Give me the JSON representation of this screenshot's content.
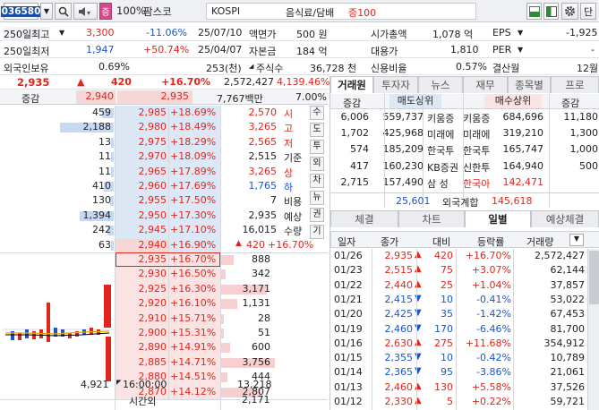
{
  "toolbar": {
    "code": "036580",
    "search_icon": "search-icon",
    "speaker_icon": "speaker-icon",
    "zoom": "100%",
    "name": "팜스코",
    "market": "KOSPI",
    "sector": "음식료/담배",
    "margin": "증100",
    "margin_badge": "증"
  },
  "info": {
    "row1": {
      "l1": "250일최고",
      "v1": "3,300",
      "v2": "-11.06%",
      "v3": "25/07/10",
      "l2": "액면가",
      "v4": "500 원",
      "l3": "시가총액",
      "v5": "1,078 억",
      "l4": "EPS",
      "v6": "-1,925"
    },
    "row2": {
      "l1": "250일최저",
      "v1": "1,947",
      "v2": "+50.74%",
      "v3": "25/04/07",
      "l2": "자본금",
      "v4": "184 억",
      "l3": "대용가",
      "v5": "1,810",
      "l4": "PER",
      "v6": "-"
    },
    "row3": {
      "l1": "외국인보유",
      "v1": "0.69%",
      "v3": "253(천)",
      "l2": "주식수",
      "v4": "36,728 천",
      "l3": "신용비율",
      "v5": "0.57%",
      "l4": "결산월",
      "v6": "12월"
    }
  },
  "quote": {
    "price": "2,935",
    "arrow": "▲",
    "change": "420",
    "rate": "+16.70%",
    "volume": "2,572,427",
    "vol_rate": "4,139.46%",
    "label": "증감",
    "prev": "2,940",
    "cur": "2,935",
    "amount": "7,767백만",
    "turnover": "7.00%"
  },
  "asks": [
    {
      "qty": "459",
      "price": "2,985",
      "rate": "+18.69%"
    },
    {
      "qty": "2,188",
      "price": "2,980",
      "rate": "+18.49%"
    },
    {
      "qty": "13",
      "price": "2,975",
      "rate": "+18.29%"
    },
    {
      "qty": "11",
      "price": "2,970",
      "rate": "+18.09%"
    },
    {
      "qty": "11",
      "price": "2,965",
      "rate": "+17.89%"
    },
    {
      "qty": "410",
      "price": "2,960",
      "rate": "+17.69%"
    },
    {
      "qty": "130",
      "price": "2,955",
      "rate": "+17.50%"
    },
    {
      "qty": "1,394",
      "price": "2,950",
      "rate": "+17.30%"
    },
    {
      "qty": "242",
      "price": "2,945",
      "rate": "+17.10%"
    },
    {
      "qty": "63",
      "price": "2,940",
      "rate": "+16.90%"
    }
  ],
  "bids": [
    {
      "price": "2,935",
      "rate": "+16.70%",
      "qty": "888"
    },
    {
      "price": "2,930",
      "rate": "+16.50%",
      "qty": "342"
    },
    {
      "price": "2,925",
      "rate": "+16.30%",
      "qty": "3,171"
    },
    {
      "price": "2,920",
      "rate": "+16.10%",
      "qty": "1,131"
    },
    {
      "price": "2,910",
      "rate": "+15.71%",
      "qty": "28"
    },
    {
      "price": "2,900",
      "rate": "+15.31%",
      "qty": "51"
    },
    {
      "price": "2,890",
      "rate": "+14.91%",
      "qty": "600"
    },
    {
      "price": "2,885",
      "rate": "+14.71%",
      "qty": "3,756"
    },
    {
      "price": "2,880",
      "rate": "+14.51%",
      "qty": "444"
    },
    {
      "price": "2,870",
      "rate": "+14.12%",
      "qty": "2,807"
    }
  ],
  "summary": [
    {
      "val": "2,570",
      "lbl": "시"
    },
    {
      "val": "3,265",
      "lbl": "고"
    },
    {
      "val": "2,565",
      "lbl": "저"
    },
    {
      "val": "2,515",
      "lbl": "기준"
    },
    {
      "val": "3,265",
      "lbl": "상"
    },
    {
      "val": "1,765",
      "lbl": "하"
    },
    {
      "val": "7",
      "lbl": "비용"
    },
    {
      "val": "2,935",
      "lbl": "예상"
    },
    {
      "val": "16,015",
      "lbl": "수량"
    },
    {
      "arrow": "▲",
      "val": "420",
      "rate": "+16.70%"
    }
  ],
  "side_buttons": [
    "수",
    "도",
    "투",
    "외",
    "차",
    "뉴",
    "권",
    "기"
  ],
  "bottom": {
    "total_ask": "4,921",
    "time": "16:00:00",
    "total_bid": "13,218",
    "after_label": "시간외",
    "after_qty": "2,171"
  },
  "broker_tabs": [
    "거래원",
    "투자자",
    "뉴스",
    "재무",
    "종목별",
    "프로"
  ],
  "broker_header": {
    "h1": "증감",
    "h2": "매도상위",
    "h3": "매수상위",
    "h4": "증감"
  },
  "brokers": [
    {
      "chg": "6,006",
      "sell": "559,737",
      "sname": "키움증",
      "bname": "키움증",
      "buy": "684,696",
      "bchg": "11,180"
    },
    {
      "chg": "1,702",
      "sell": "425,968",
      "sname": "미래에",
      "bname": "미래에",
      "buy": "319,210",
      "bchg": "1,300"
    },
    {
      "chg": "574",
      "sell": "185,209",
      "sname": "한국투",
      "bname": "한국투",
      "buy": "165,747",
      "bchg": "1,000"
    },
    {
      "chg": "417",
      "sell": "160,230",
      "sname": "KB증권",
      "bname": "신한투",
      "buy": "164,940",
      "bchg": "500"
    },
    {
      "chg": "2,715",
      "sell": "157,490",
      "sname": "삼 성",
      "bname": "한국아",
      "buy": "142,471",
      "bchg": ""
    }
  ],
  "foreign": {
    "sell": "25,601",
    "label": "외국계합",
    "buy": "145,618"
  },
  "daily_tabs": [
    "체결",
    "차트",
    "일별",
    "예상체결"
  ],
  "daily_header": {
    "date": "일자",
    "close": "종가",
    "change": "대비",
    "rate": "등락률",
    "volume": "거래량"
  },
  "daily": [
    {
      "date": "01/26",
      "close": "2,935",
      "dir": "up",
      "chg": "420",
      "rate": "+16.70%",
      "vol": "2,572,427"
    },
    {
      "date": "01/23",
      "close": "2,515",
      "dir": "up",
      "chg": "75",
      "rate": "+3.07%",
      "vol": "62,144"
    },
    {
      "date": "01/22",
      "close": "2,440",
      "dir": "up",
      "chg": "25",
      "rate": "+1.04%",
      "vol": "37,857"
    },
    {
      "date": "01/21",
      "close": "2,415",
      "dir": "down",
      "chg": "10",
      "rate": "-0.41%",
      "vol": "53,022"
    },
    {
      "date": "01/20",
      "close": "2,425",
      "dir": "down",
      "chg": "35",
      "rate": "-1.42%",
      "vol": "67,453"
    },
    {
      "date": "01/19",
      "close": "2,460",
      "dir": "down",
      "chg": "170",
      "rate": "-6.46%",
      "vol": "81,700"
    },
    {
      "date": "01/16",
      "close": "2,630",
      "dir": "up",
      "chg": "275",
      "rate": "+11.68%",
      "vol": "354,912"
    },
    {
      "date": "01/15",
      "close": "2,355",
      "dir": "down",
      "chg": "10",
      "rate": "-0.42%",
      "vol": "10,789"
    },
    {
      "date": "01/14",
      "close": "2,365",
      "dir": "down",
      "chg": "95",
      "rate": "-3.86%",
      "vol": "21,061"
    },
    {
      "date": "01/13",
      "close": "2,460",
      "dir": "up",
      "chg": "130",
      "rate": "+5.58%",
      "vol": "37,526"
    },
    {
      "date": "01/12",
      "close": "2,330",
      "dir": "up",
      "chg": "5",
      "rate": "+0.22%",
      "vol": "59,721"
    }
  ],
  "colors": {
    "up": "#e0261c",
    "down": "#1b55cc",
    "ask_bg": "#dde8f7",
    "bid_bg": "#fbe3e3",
    "ask_bar": "#c7d9f2",
    "bid_bar": "#f7cfd0"
  }
}
